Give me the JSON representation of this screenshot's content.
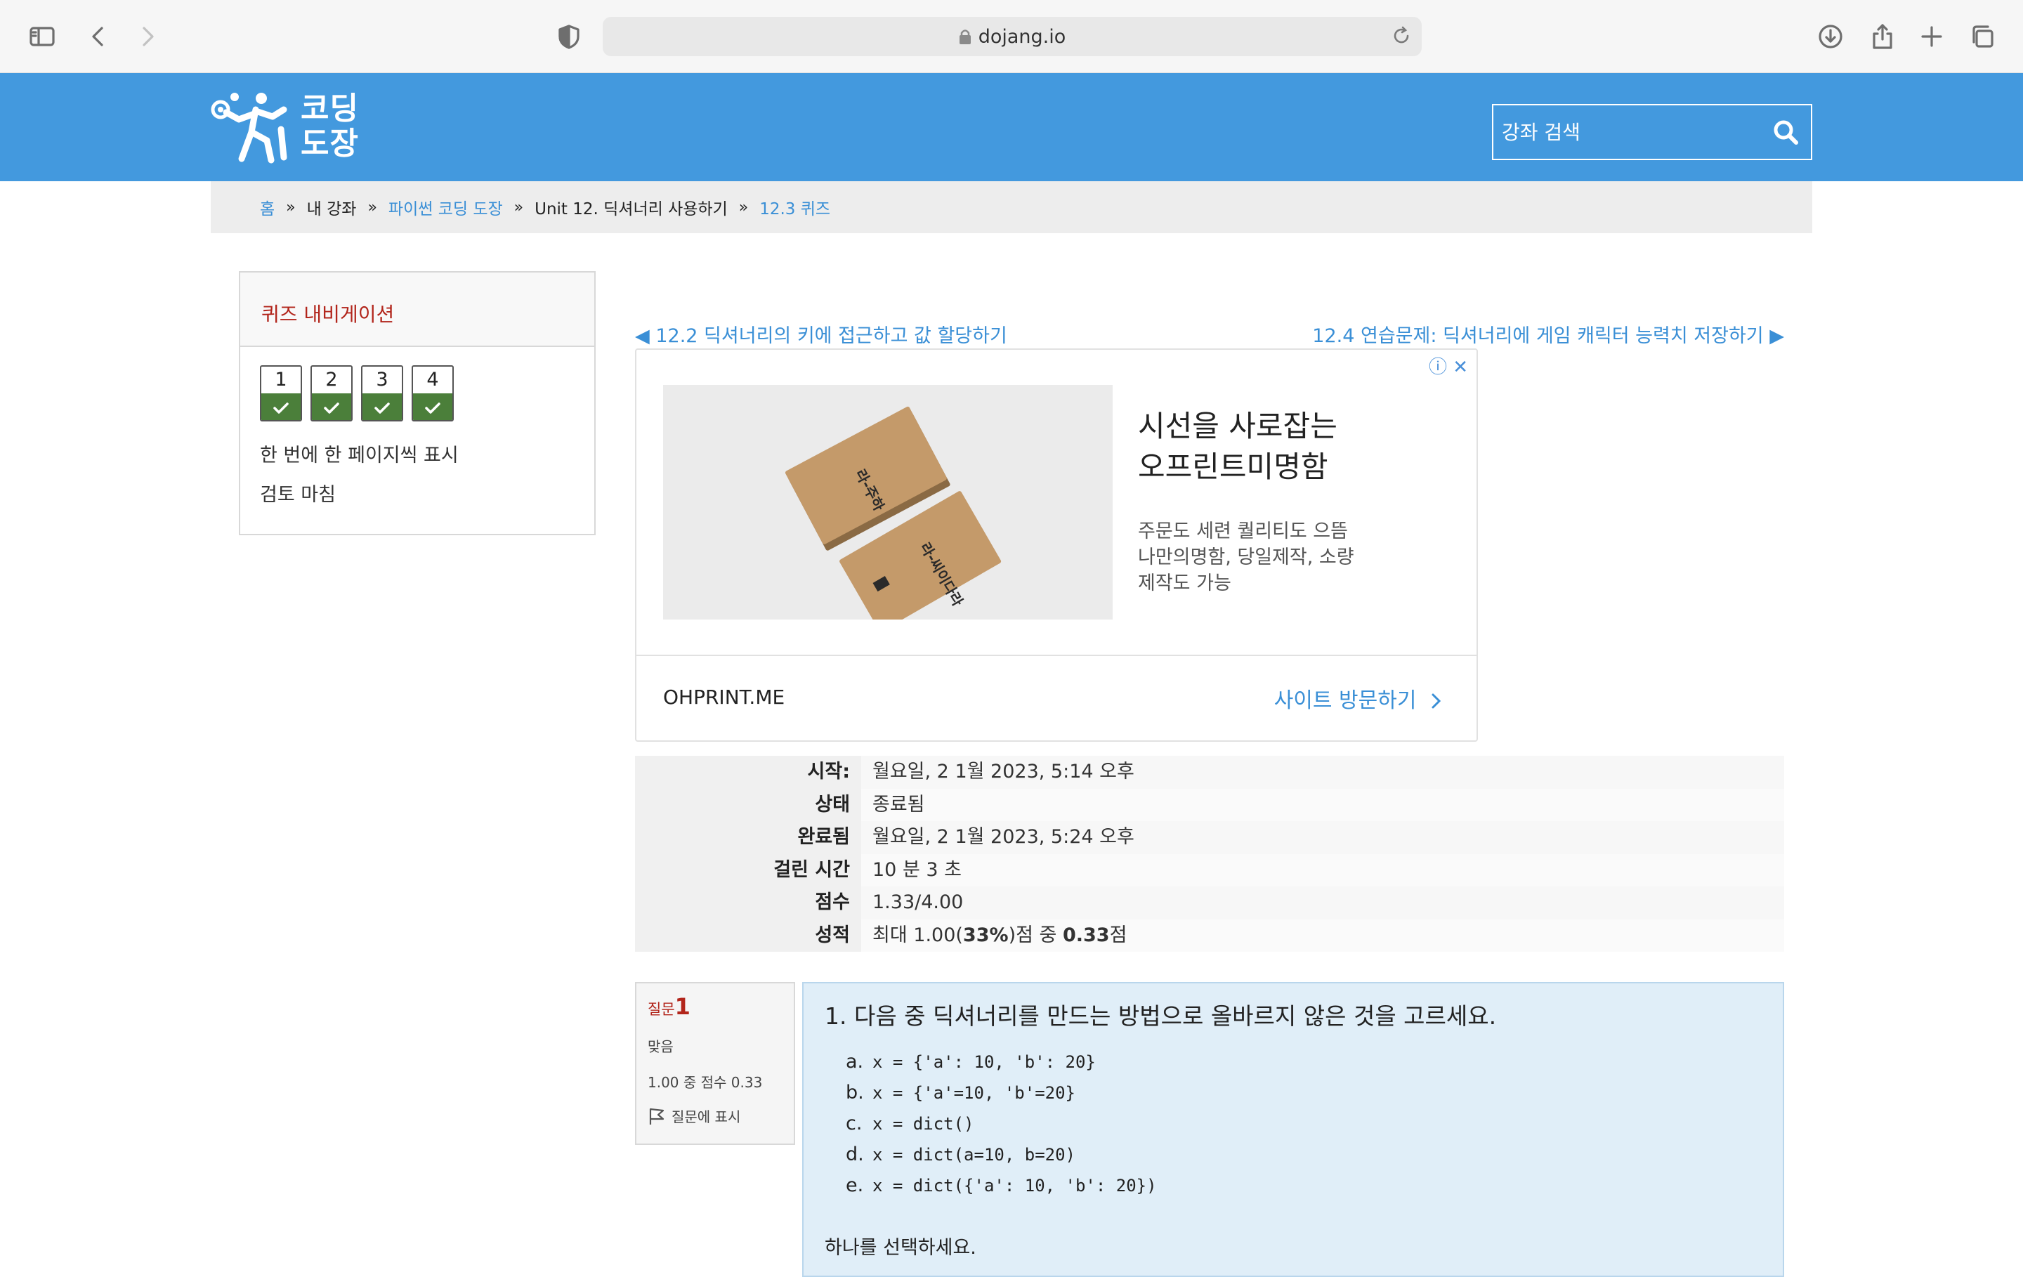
{
  "browser": {
    "url": "dojang.io"
  },
  "header": {
    "logo_text_line1": "코딩",
    "logo_text_line2": "도장",
    "search_placeholder": "강좌 검색"
  },
  "breadcrumb": {
    "home": "홈",
    "my_courses": "내 강좌",
    "course": "파이썬 코딩 도장",
    "unit": "Unit 12. 딕셔너리 사용하기",
    "current": "12.3 퀴즈",
    "separator": "»"
  },
  "quiz_nav": {
    "title": "퀴즈 내비게이션",
    "questions": [
      "1",
      "2",
      "3",
      "4"
    ],
    "show_one_page": "한 번에 한 페이지씩 표시",
    "finish_review": "검토 마침"
  },
  "pagination": {
    "prev": "◀ 12.2 딕셔너리의 키에 접근하고 값 할당하기",
    "next": "12.4 연습문제: 딕셔너리에 게임 캐릭터 능력치 저장하기 ▶"
  },
  "ad": {
    "icons": "ⓘ ✕",
    "title_line1": "시선을 사로잡는",
    "title_line2": "오프린트미명함",
    "desc_line1": "주문도 세련 퀄리티도 으뜸",
    "desc_line2": "나만의명함, 당일제작, 소량",
    "desc_line3": "제작도 가능",
    "domain": "OHPRINT.ME",
    "cta": "사이트 방문하기",
    "card_text_1": "라-주하",
    "card_text_2": "라-씨이다라"
  },
  "summary": [
    {
      "label": "시작:",
      "value": "월요일, 2 1월 2023, 5:14 오후"
    },
    {
      "label": "상태",
      "value": "종료됨"
    },
    {
      "label": "완료됨",
      "value": "월요일, 2 1월 2023, 5:24 오후"
    },
    {
      "label": "걸린 시간",
      "value": "10 분 3 초"
    },
    {
      "label": "점수",
      "value": "1.33/4.00"
    }
  ],
  "grade": {
    "label": "성적",
    "prefix": "최대 1.00(",
    "percent": "33%",
    "middle": ")점 중 ",
    "score": "0.33",
    "suffix": "점"
  },
  "question": {
    "label": "질문",
    "number": "1",
    "status": "맞음",
    "mark": "1.00 중 점수 0.33",
    "flag": "질문에 표시",
    "text": "1. 다음 중 딕셔너리를 만드는 방법으로 올바르지 않은 것을 고르세요.",
    "answers": [
      {
        "label": "a.",
        "code": "x = {'a': 10, 'b': 20}"
      },
      {
        "label": "b.",
        "code": "x = {'a'=10, 'b'=20}"
      },
      {
        "label": "c.",
        "code": "x = dict()"
      },
      {
        "label": "d.",
        "code": "x = dict(a=10, b=20)"
      },
      {
        "label": "e.",
        "code": "x = dict({'a': 10, 'b': 20})"
      }
    ],
    "prompt": "하나를 선택하세요."
  },
  "colors": {
    "header_blue": "#4399de",
    "link_blue": "#3a8fd6",
    "nav_title_red": "#b2251b",
    "answered_green": "#4b7f3a",
    "question_bg": "#e0eef8"
  }
}
